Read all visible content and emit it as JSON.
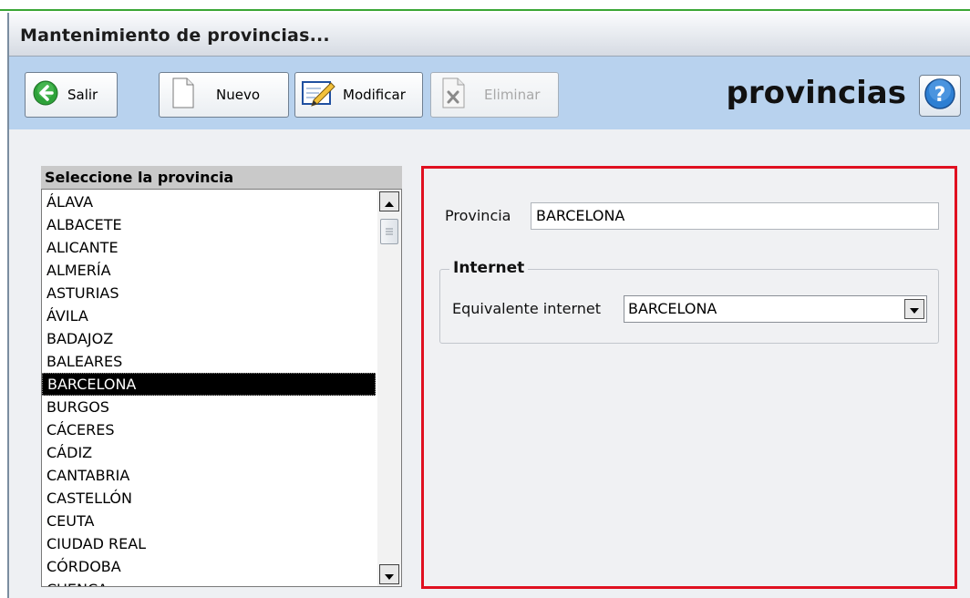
{
  "window": {
    "title": "Mantenimiento de provincias..."
  },
  "toolbar": {
    "exit_label": "Salir",
    "new_label": "Nuevo",
    "edit_label": "Modificar",
    "delete_label": "Eliminar",
    "heading": "provincias",
    "help_icon": "question-mark-icon"
  },
  "list": {
    "header": "Seleccione la provincia",
    "items": [
      "ÁLAVA",
      "ALBACETE",
      "ALICANTE",
      "ALMERÍA",
      "ASTURIAS",
      "ÁVILA",
      "BADAJOZ",
      "BALEARES",
      "BARCELONA",
      "BURGOS",
      "CÁCERES",
      "CÁDIZ",
      "CANTABRIA",
      "CASTELLÓN",
      "CEUTA",
      "CIUDAD REAL",
      "CÓRDOBA",
      "CUENCA"
    ],
    "selected": "BARCELONA"
  },
  "detail": {
    "province_label": "Provincia",
    "province_value": "BARCELONA",
    "group_title": "Internet",
    "internet_label": "Equivalente internet",
    "internet_value": "BARCELONA"
  },
  "colors": {
    "accent_red": "#e01020",
    "toolbar_blue": "#b8d2ee",
    "exit_green": "#2ea23a",
    "help_blue": "#2d7fd3"
  }
}
